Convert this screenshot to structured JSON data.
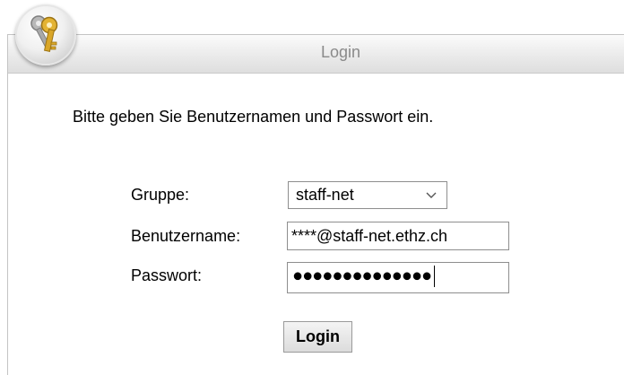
{
  "window": {
    "title": "Login",
    "logo_icon": "keys-icon"
  },
  "form": {
    "intro": "Bitte geben Sie Benutzernamen und Passwort ein.",
    "group_label": "Gruppe:",
    "group_value": "staff-net",
    "username_label": "Benutzername:",
    "username_value": "****@staff-net.ethz.ch",
    "password_label": "Passwort:",
    "password_mask": "●●●●●●●●●●●●●●",
    "submit_label": "Login"
  }
}
